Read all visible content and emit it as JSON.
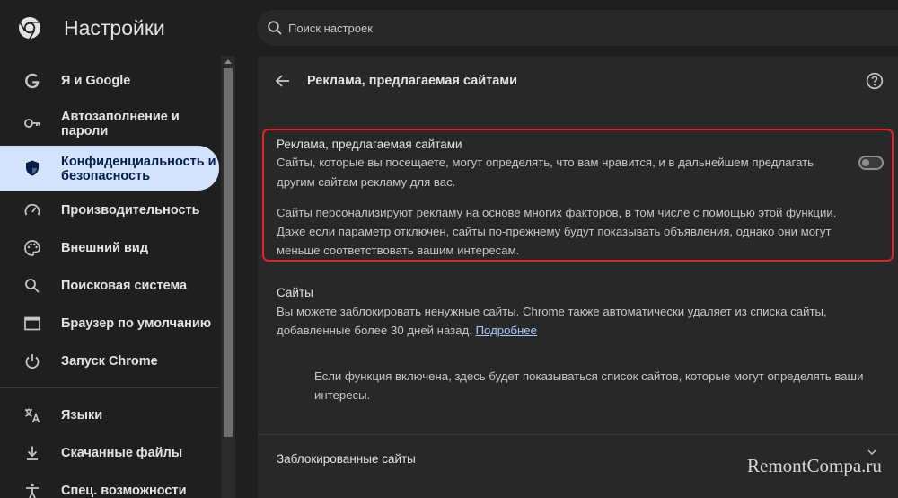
{
  "app": {
    "title": "Настройки"
  },
  "search": {
    "placeholder": "Поиск настроек"
  },
  "sidebar": {
    "items": [
      {
        "label": "Я и Google",
        "icon": "google-g-icon"
      },
      {
        "label": "Автозаполнение и пароли",
        "icon": "key-icon"
      },
      {
        "label": "Конфиденциальность и безопасность",
        "icon": "shield-icon",
        "active": true
      },
      {
        "label": "Производительность",
        "icon": "speedometer-icon"
      },
      {
        "label": "Внешний вид",
        "icon": "palette-icon"
      },
      {
        "label": "Поисковая система",
        "icon": "search-icon"
      },
      {
        "label": "Браузер по умолчанию",
        "icon": "browser-window-icon"
      },
      {
        "label": "Запуск Chrome",
        "icon": "power-icon"
      },
      {
        "label": "Языки",
        "icon": "translate-icon"
      },
      {
        "label": "Скачанные файлы",
        "icon": "download-icon"
      },
      {
        "label": "Спец. возможности",
        "icon": "accessibility-icon"
      }
    ]
  },
  "main": {
    "title": "Реклама, предлагаемая сайтами",
    "section1": {
      "title": "Реклама, предлагаемая сайтами",
      "desc_line1": "Сайты, которые вы посещаете, могут определять, что вам нравится, и в дальнейшем предлагать",
      "desc_line2": "другим сайтам рекламу для вас.",
      "note_line1": "Сайты персонализируют рекламу на основе многих факторов, в том числе с помощью этой функции.",
      "note_line2": "Даже если параметр отключен, сайты по-прежнему будут показывать объявления, однако они могут",
      "note_line3": "меньше соответствовать вашим интересам.",
      "toggle_on": false
    },
    "sites": {
      "title": "Сайты",
      "desc_line1": "Вы можете заблокировать ненужные сайты. Chrome также автоматически удаляет из списка сайты,",
      "desc_line2": "добавленные более 30 дней назад.",
      "link": "Подробнее",
      "empty_line1": "Если функция включена, здесь будет показываться список сайтов, которые могут определять ваши",
      "empty_line2": "интересы."
    },
    "blocked": {
      "title": "Заблокированные сайты"
    }
  },
  "watermark": "RemontCompa.ru",
  "colors": {
    "accent": "#d3e3fd",
    "highlight_border": "#e2242a",
    "link": "#a8c7fa"
  }
}
